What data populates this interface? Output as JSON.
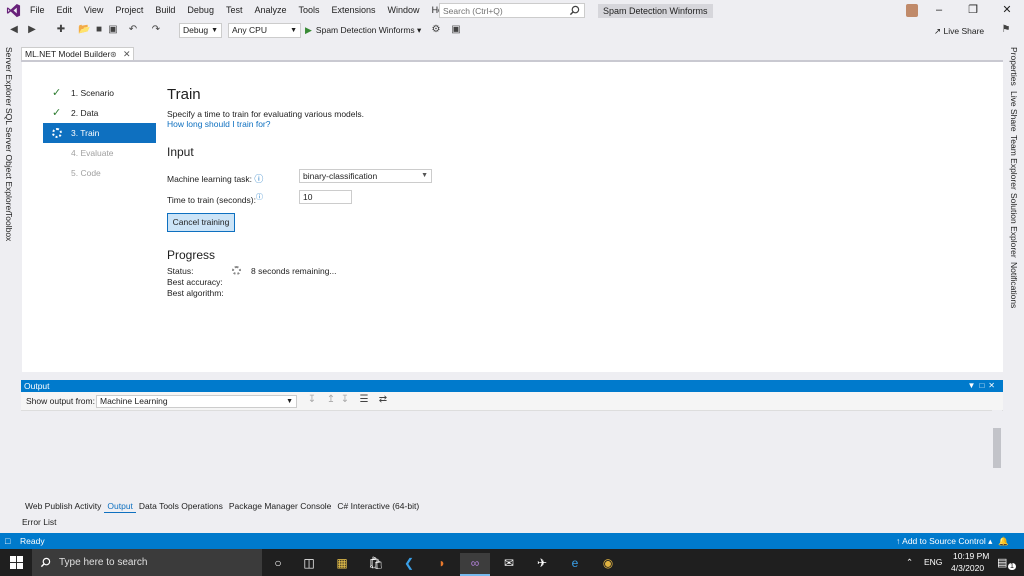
{
  "menu": {
    "items": [
      "File",
      "Edit",
      "View",
      "Project",
      "Build",
      "Debug",
      "Test",
      "Analyze",
      "Tools",
      "Extensions",
      "Window",
      "Help"
    ],
    "search_placeholder": "Search (Ctrl+Q)",
    "solution_title": "Spam Detection Winforms"
  },
  "toolbar": {
    "config": "Debug",
    "platform": "Any CPU",
    "run_target": "Spam Detection Winforms",
    "live_share": "Live Share"
  },
  "left_tabs": [
    "Server Explorer",
    "SQL Server Object Explorer",
    "Toolbox"
  ],
  "right_tabs": [
    "Properties",
    "Live Share",
    "Team Explorer",
    "Solution Explorer",
    "Notifications"
  ],
  "document_tab": "ML.NET Model Builder",
  "steps": [
    {
      "label": "1. Scenario",
      "state": "done"
    },
    {
      "label": "2. Data",
      "state": "done"
    },
    {
      "label": "3. Train",
      "state": "active"
    },
    {
      "label": "4. Evaluate",
      "state": "disabled"
    },
    {
      "label": "5. Code",
      "state": "disabled"
    }
  ],
  "train": {
    "title": "Train",
    "description": "Specify a time to train for evaluating various models.",
    "help_link": "How long should I train for?",
    "input_heading": "Input",
    "task_label": "Machine learning task:",
    "task_value": "binary-classification",
    "time_label": "Time to train (seconds):",
    "time_value": "10",
    "cancel_button": "Cancel training",
    "progress_heading": "Progress",
    "status_label": "Status:",
    "status_value": "8 seconds remaining...",
    "best_accuracy_label": "Best accuracy:",
    "best_algorithm_label": "Best algorithm:"
  },
  "output": {
    "title": "Output",
    "show_from_label": "Show output from:",
    "source": "Machine Learning"
  },
  "bottom_tabs": [
    "Web Publish Activity",
    "Output",
    "Data Tools Operations",
    "Package Manager Console",
    "C# Interactive (64-bit)"
  ],
  "error_list": "Error List",
  "status": {
    "ready": "Ready",
    "source_control": "Add to Source Control"
  },
  "taskbar": {
    "search_placeholder": "Type here to search",
    "lang": "ENG",
    "time": "10:19 PM",
    "date": "4/3/2020",
    "notification_count": "1"
  },
  "colors": {
    "accent": "#007acc",
    "active_step": "#0e70c0",
    "vs_purple": "#68217a"
  }
}
